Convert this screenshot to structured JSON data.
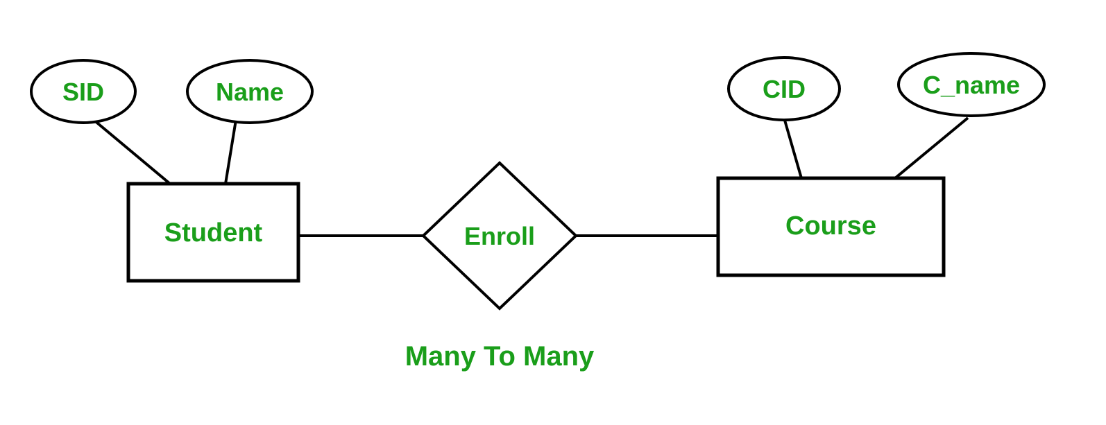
{
  "entities": {
    "student": {
      "label": "Student",
      "attributes": {
        "sid": "SID",
        "name": "Name"
      }
    },
    "course": {
      "label": "Course",
      "attributes": {
        "cid": "CID",
        "cname": "C_name"
      }
    }
  },
  "relationship": {
    "enroll": "Enroll"
  },
  "caption": "Many To Many"
}
